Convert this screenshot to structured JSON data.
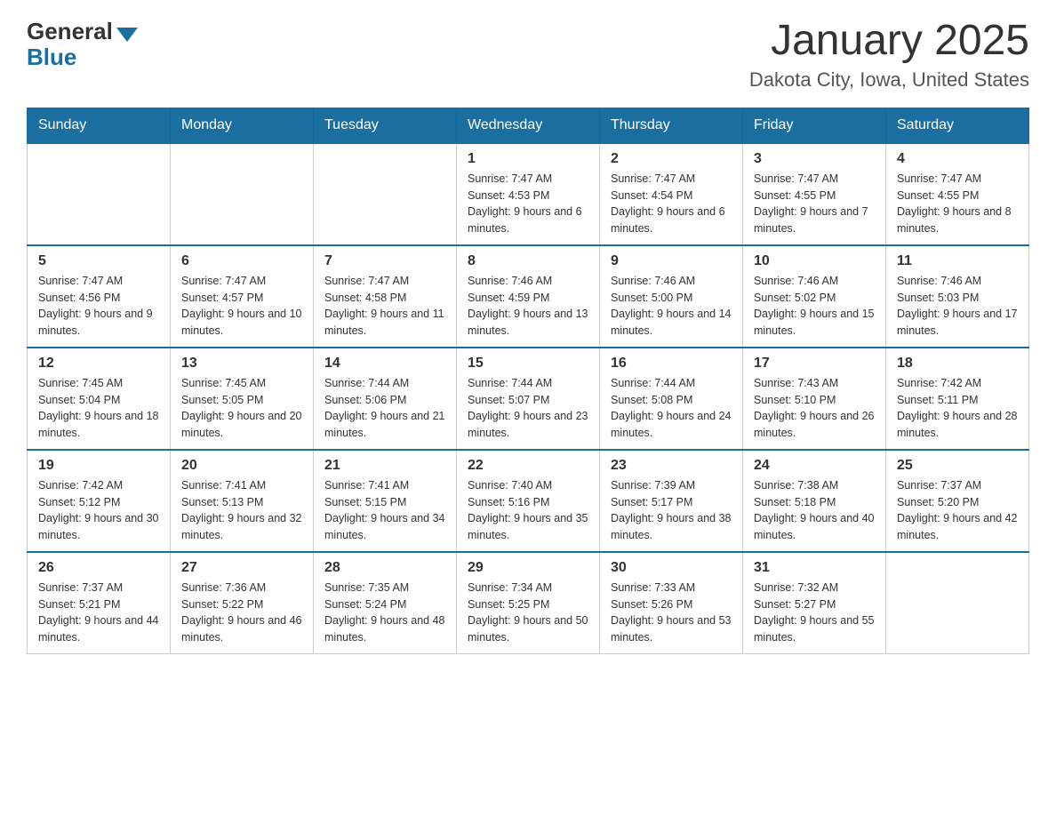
{
  "header": {
    "logo_general": "General",
    "logo_blue": "Blue",
    "month_title": "January 2025",
    "location": "Dakota City, Iowa, United States"
  },
  "days_of_week": [
    "Sunday",
    "Monday",
    "Tuesday",
    "Wednesday",
    "Thursday",
    "Friday",
    "Saturday"
  ],
  "weeks": [
    [
      {
        "day": "",
        "info": ""
      },
      {
        "day": "",
        "info": ""
      },
      {
        "day": "",
        "info": ""
      },
      {
        "day": "1",
        "info": "Sunrise: 7:47 AM\nSunset: 4:53 PM\nDaylight: 9 hours and 6 minutes."
      },
      {
        "day": "2",
        "info": "Sunrise: 7:47 AM\nSunset: 4:54 PM\nDaylight: 9 hours and 6 minutes."
      },
      {
        "day": "3",
        "info": "Sunrise: 7:47 AM\nSunset: 4:55 PM\nDaylight: 9 hours and 7 minutes."
      },
      {
        "day": "4",
        "info": "Sunrise: 7:47 AM\nSunset: 4:55 PM\nDaylight: 9 hours and 8 minutes."
      }
    ],
    [
      {
        "day": "5",
        "info": "Sunrise: 7:47 AM\nSunset: 4:56 PM\nDaylight: 9 hours and 9 minutes."
      },
      {
        "day": "6",
        "info": "Sunrise: 7:47 AM\nSunset: 4:57 PM\nDaylight: 9 hours and 10 minutes."
      },
      {
        "day": "7",
        "info": "Sunrise: 7:47 AM\nSunset: 4:58 PM\nDaylight: 9 hours and 11 minutes."
      },
      {
        "day": "8",
        "info": "Sunrise: 7:46 AM\nSunset: 4:59 PM\nDaylight: 9 hours and 13 minutes."
      },
      {
        "day": "9",
        "info": "Sunrise: 7:46 AM\nSunset: 5:00 PM\nDaylight: 9 hours and 14 minutes."
      },
      {
        "day": "10",
        "info": "Sunrise: 7:46 AM\nSunset: 5:02 PM\nDaylight: 9 hours and 15 minutes."
      },
      {
        "day": "11",
        "info": "Sunrise: 7:46 AM\nSunset: 5:03 PM\nDaylight: 9 hours and 17 minutes."
      }
    ],
    [
      {
        "day": "12",
        "info": "Sunrise: 7:45 AM\nSunset: 5:04 PM\nDaylight: 9 hours and 18 minutes."
      },
      {
        "day": "13",
        "info": "Sunrise: 7:45 AM\nSunset: 5:05 PM\nDaylight: 9 hours and 20 minutes."
      },
      {
        "day": "14",
        "info": "Sunrise: 7:44 AM\nSunset: 5:06 PM\nDaylight: 9 hours and 21 minutes."
      },
      {
        "day": "15",
        "info": "Sunrise: 7:44 AM\nSunset: 5:07 PM\nDaylight: 9 hours and 23 minutes."
      },
      {
        "day": "16",
        "info": "Sunrise: 7:44 AM\nSunset: 5:08 PM\nDaylight: 9 hours and 24 minutes."
      },
      {
        "day": "17",
        "info": "Sunrise: 7:43 AM\nSunset: 5:10 PM\nDaylight: 9 hours and 26 minutes."
      },
      {
        "day": "18",
        "info": "Sunrise: 7:42 AM\nSunset: 5:11 PM\nDaylight: 9 hours and 28 minutes."
      }
    ],
    [
      {
        "day": "19",
        "info": "Sunrise: 7:42 AM\nSunset: 5:12 PM\nDaylight: 9 hours and 30 minutes."
      },
      {
        "day": "20",
        "info": "Sunrise: 7:41 AM\nSunset: 5:13 PM\nDaylight: 9 hours and 32 minutes."
      },
      {
        "day": "21",
        "info": "Sunrise: 7:41 AM\nSunset: 5:15 PM\nDaylight: 9 hours and 34 minutes."
      },
      {
        "day": "22",
        "info": "Sunrise: 7:40 AM\nSunset: 5:16 PM\nDaylight: 9 hours and 35 minutes."
      },
      {
        "day": "23",
        "info": "Sunrise: 7:39 AM\nSunset: 5:17 PM\nDaylight: 9 hours and 38 minutes."
      },
      {
        "day": "24",
        "info": "Sunrise: 7:38 AM\nSunset: 5:18 PM\nDaylight: 9 hours and 40 minutes."
      },
      {
        "day": "25",
        "info": "Sunrise: 7:37 AM\nSunset: 5:20 PM\nDaylight: 9 hours and 42 minutes."
      }
    ],
    [
      {
        "day": "26",
        "info": "Sunrise: 7:37 AM\nSunset: 5:21 PM\nDaylight: 9 hours and 44 minutes."
      },
      {
        "day": "27",
        "info": "Sunrise: 7:36 AM\nSunset: 5:22 PM\nDaylight: 9 hours and 46 minutes."
      },
      {
        "day": "28",
        "info": "Sunrise: 7:35 AM\nSunset: 5:24 PM\nDaylight: 9 hours and 48 minutes."
      },
      {
        "day": "29",
        "info": "Sunrise: 7:34 AM\nSunset: 5:25 PM\nDaylight: 9 hours and 50 minutes."
      },
      {
        "day": "30",
        "info": "Sunrise: 7:33 AM\nSunset: 5:26 PM\nDaylight: 9 hours and 53 minutes."
      },
      {
        "day": "31",
        "info": "Sunrise: 7:32 AM\nSunset: 5:27 PM\nDaylight: 9 hours and 55 minutes."
      },
      {
        "day": "",
        "info": ""
      }
    ]
  ]
}
